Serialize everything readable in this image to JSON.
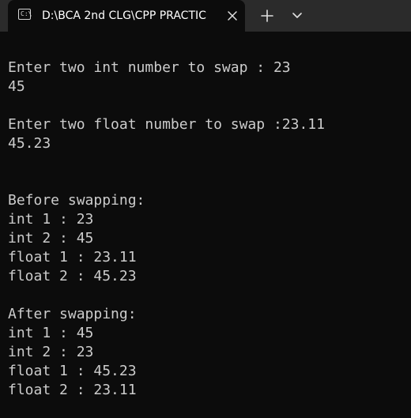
{
  "window": {
    "tab_title": "D:\\BCA 2nd CLG\\CPP PRACTIC",
    "icons": {
      "terminal": "terminal-icon",
      "close": "close-icon",
      "new_tab": "plus-icon",
      "dropdown": "chevron-down-icon"
    }
  },
  "console": {
    "lines": [
      "Enter two int number to swap : 23",
      "45",
      "",
      "Enter two float number to swap :23.11",
      "45.23",
      "",
      "",
      "Before swapping:",
      "int 1 : 23",
      "int 2 : 45",
      "float 1 : 23.11",
      "float 2 : 45.23",
      "",
      "After swapping:",
      "int 1 : 45",
      "int 2 : 23",
      "float 1 : 45.23",
      "float 2 : 23.11"
    ]
  },
  "colors": {
    "background": "#0c0c0c",
    "titlebar": "#2b2b2b",
    "text": "#cccccc"
  }
}
